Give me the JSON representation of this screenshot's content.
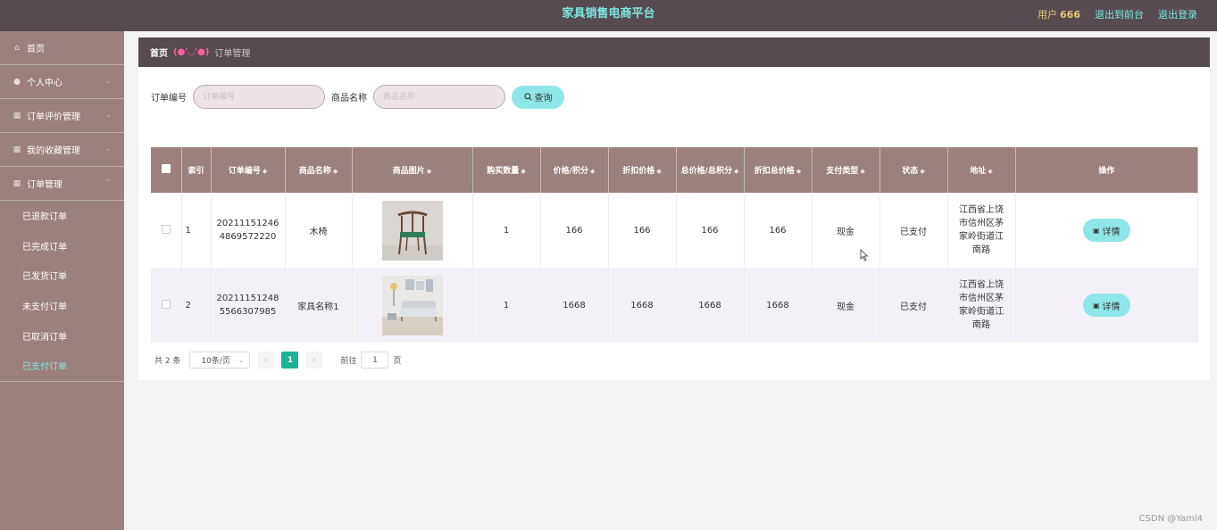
{
  "header": {
    "title": "家具销售电商平台",
    "user_label": "用户",
    "user_name": "666",
    "exit_front": "退出到前台",
    "logout": "退出登录"
  },
  "sidebar": {
    "items": [
      {
        "label": "首页",
        "icon": "home-icon"
      },
      {
        "label": "个人中心",
        "icon": "user-icon"
      },
      {
        "label": "订单评价管理",
        "icon": "menu-icon"
      },
      {
        "label": "我的收藏管理",
        "icon": "menu-icon"
      },
      {
        "label": "订单管理",
        "icon": "menu-icon"
      }
    ],
    "sub_items": [
      "已退款订单",
      "已完成订单",
      "已发货订单",
      "未支付订单",
      "已取消订单",
      "已支付订单"
    ],
    "active_sub": "已支付订单"
  },
  "breadcrumb": {
    "home": "首页",
    "emoticon": "(●'◡'●)",
    "current": "订单管理"
  },
  "search": {
    "order_label": "订单编号",
    "order_placeholder": "订单编号",
    "product_label": "商品名称",
    "product_placeholder": "商品名称",
    "button": "查询"
  },
  "table": {
    "columns": [
      "索引",
      "订单编号",
      "商品名称",
      "商品图片",
      "购买数量",
      "价格/积分",
      "折扣价格",
      "总价格/总积分",
      "折扣总价格",
      "支付类型",
      "状态",
      "地址",
      "操作"
    ],
    "rows": [
      {
        "index": "1",
        "order_no": "202111512464869572220",
        "product": "木椅",
        "image": "chair-photo",
        "qty": "1",
        "price": "166",
        "discount": "166",
        "total": "166",
        "discount_total": "166",
        "pay_type": "现金",
        "status": "已支付",
        "address": "江西省上饶市信州区茅家岭街道江南路",
        "action": "详情"
      },
      {
        "index": "2",
        "order_no": "202111512485566307985",
        "product": "家具名称1",
        "image": "sofa-photo",
        "qty": "1",
        "price": "1668",
        "discount": "1668",
        "total": "1668",
        "discount_total": "1668",
        "pay_type": "现金",
        "status": "已支付",
        "address": "江西省上饶市信州区茅家岭街道江南路",
        "action": "详情"
      }
    ]
  },
  "pagination": {
    "total": "共 2 条",
    "page_size": "10条/页",
    "current_page": "1",
    "goto_label": "前往",
    "goto_value": "1",
    "page_suffix": "页"
  },
  "watermark": "CSDN @Yaml4",
  "colors": {
    "topbar": "#564b50",
    "sidebar": "#9c807d",
    "accent": "#7fe6e2",
    "button": "#8ee6e8",
    "page_active": "#1ab394"
  }
}
